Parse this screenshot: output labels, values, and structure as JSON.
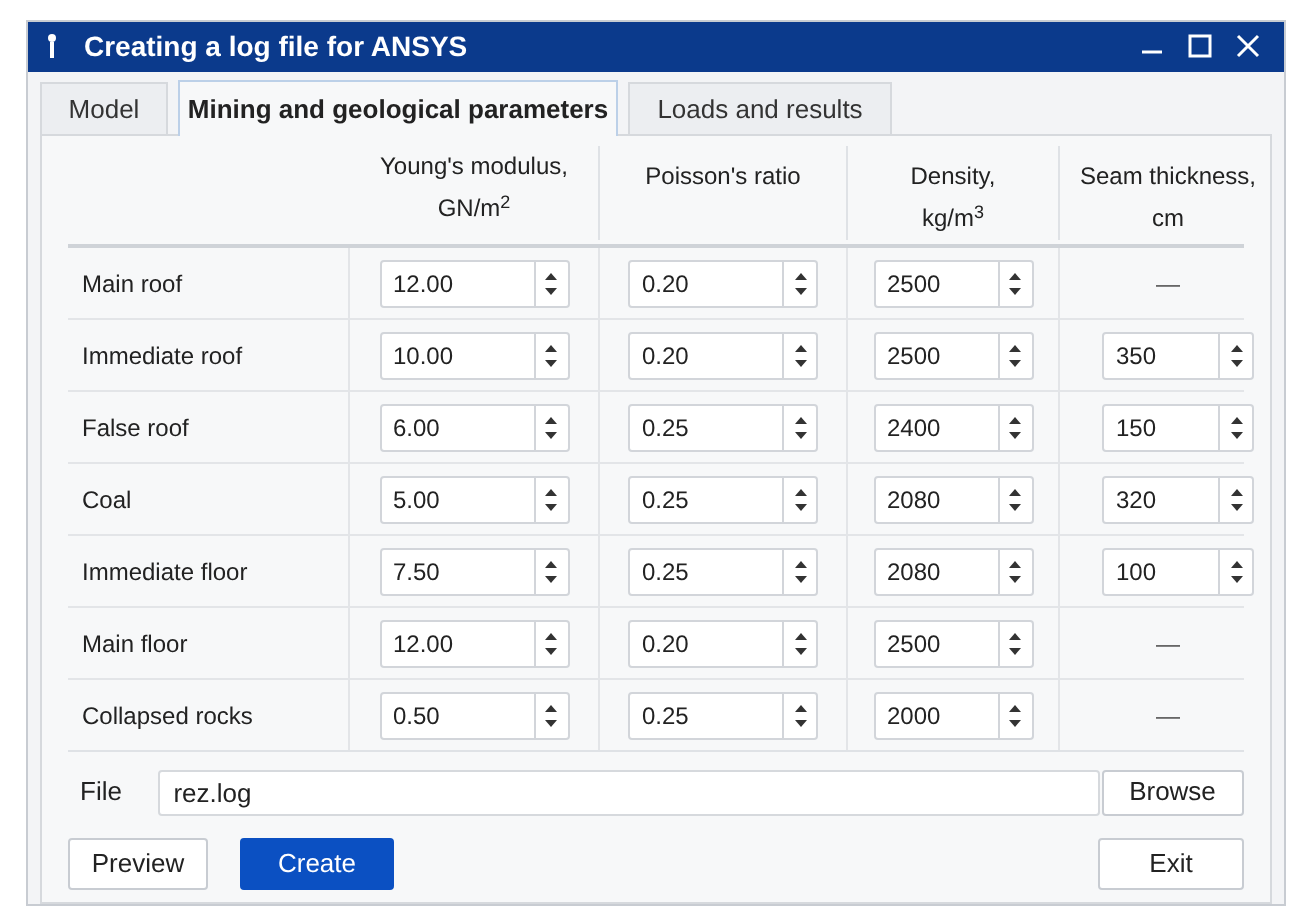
{
  "window": {
    "title": "Creating a log file for ANSYS"
  },
  "tabs": [
    {
      "label": "Model",
      "selected": false
    },
    {
      "label": "Mining and geological parameters",
      "selected": true
    },
    {
      "label": "Loads and results",
      "selected": false
    }
  ],
  "table": {
    "columns": [
      "",
      "Young's modulus, GN/m$^{2}$",
      "Poisson's ratio",
      "Density, kg/m$^{3}$",
      "Seam thickness, cm"
    ],
    "rows": [
      {
        "cells": [
          {
            "kind": "label",
            "text": "Main roof"
          },
          {
            "kind": "spin",
            "value": "12.00"
          },
          {
            "kind": "spin",
            "value": "0.20"
          },
          {
            "kind": "spin",
            "value": "2500"
          },
          {
            "kind": "dash",
            "text": "—"
          }
        ]
      },
      {
        "cells": [
          {
            "kind": "label",
            "text": "Immediate roof"
          },
          {
            "kind": "spin",
            "value": "10.00"
          },
          {
            "kind": "spin",
            "value": "0.20"
          },
          {
            "kind": "spin",
            "value": "2500"
          },
          {
            "kind": "spin",
            "value": "350"
          }
        ]
      },
      {
        "cells": [
          {
            "kind": "label",
            "text": "False roof"
          },
          {
            "kind": "spin",
            "value": "6.00"
          },
          {
            "kind": "spin",
            "value": "0.25"
          },
          {
            "kind": "spin",
            "value": "2400"
          },
          {
            "kind": "spin",
            "value": "150"
          }
        ]
      },
      {
        "cells": [
          {
            "kind": "label",
            "text": "Coal"
          },
          {
            "kind": "spin",
            "value": "5.00"
          },
          {
            "kind": "spin",
            "value": "0.25"
          },
          {
            "kind": "spin",
            "value": "2080"
          },
          {
            "kind": "spin",
            "value": "320"
          }
        ]
      },
      {
        "cells": [
          {
            "kind": "label",
            "text": "Immediate floor"
          },
          {
            "kind": "spin",
            "value": "7.50"
          },
          {
            "kind": "spin",
            "value": "0.25"
          },
          {
            "kind": "spin",
            "value": "2080"
          },
          {
            "kind": "spin",
            "value": "100"
          }
        ]
      },
      {
        "cells": [
          {
            "kind": "label",
            "text": "Main floor"
          },
          {
            "kind": "spin",
            "value": "12.00"
          },
          {
            "kind": "spin",
            "value": "0.20"
          },
          {
            "kind": "spin",
            "value": "2500"
          },
          {
            "kind": "dash",
            "text": "—"
          }
        ]
      },
      {
        "cells": [
          {
            "kind": "label",
            "text": "Collapsed rocks"
          },
          {
            "kind": "spin",
            "value": "0.50"
          },
          {
            "kind": "spin",
            "value": "0.25"
          },
          {
            "kind": "spin",
            "value": "2000"
          },
          {
            "kind": "dash",
            "text": "—"
          }
        ]
      }
    ]
  },
  "file": {
    "label": "File",
    "value": "rez.log",
    "browse": "Browse"
  },
  "buttons": [
    {
      "label": "Preview",
      "kind": "plain"
    },
    {
      "label": "Create",
      "kind": "primary"
    },
    {
      "label": "Exit",
      "kind": "plain"
    }
  ]
}
